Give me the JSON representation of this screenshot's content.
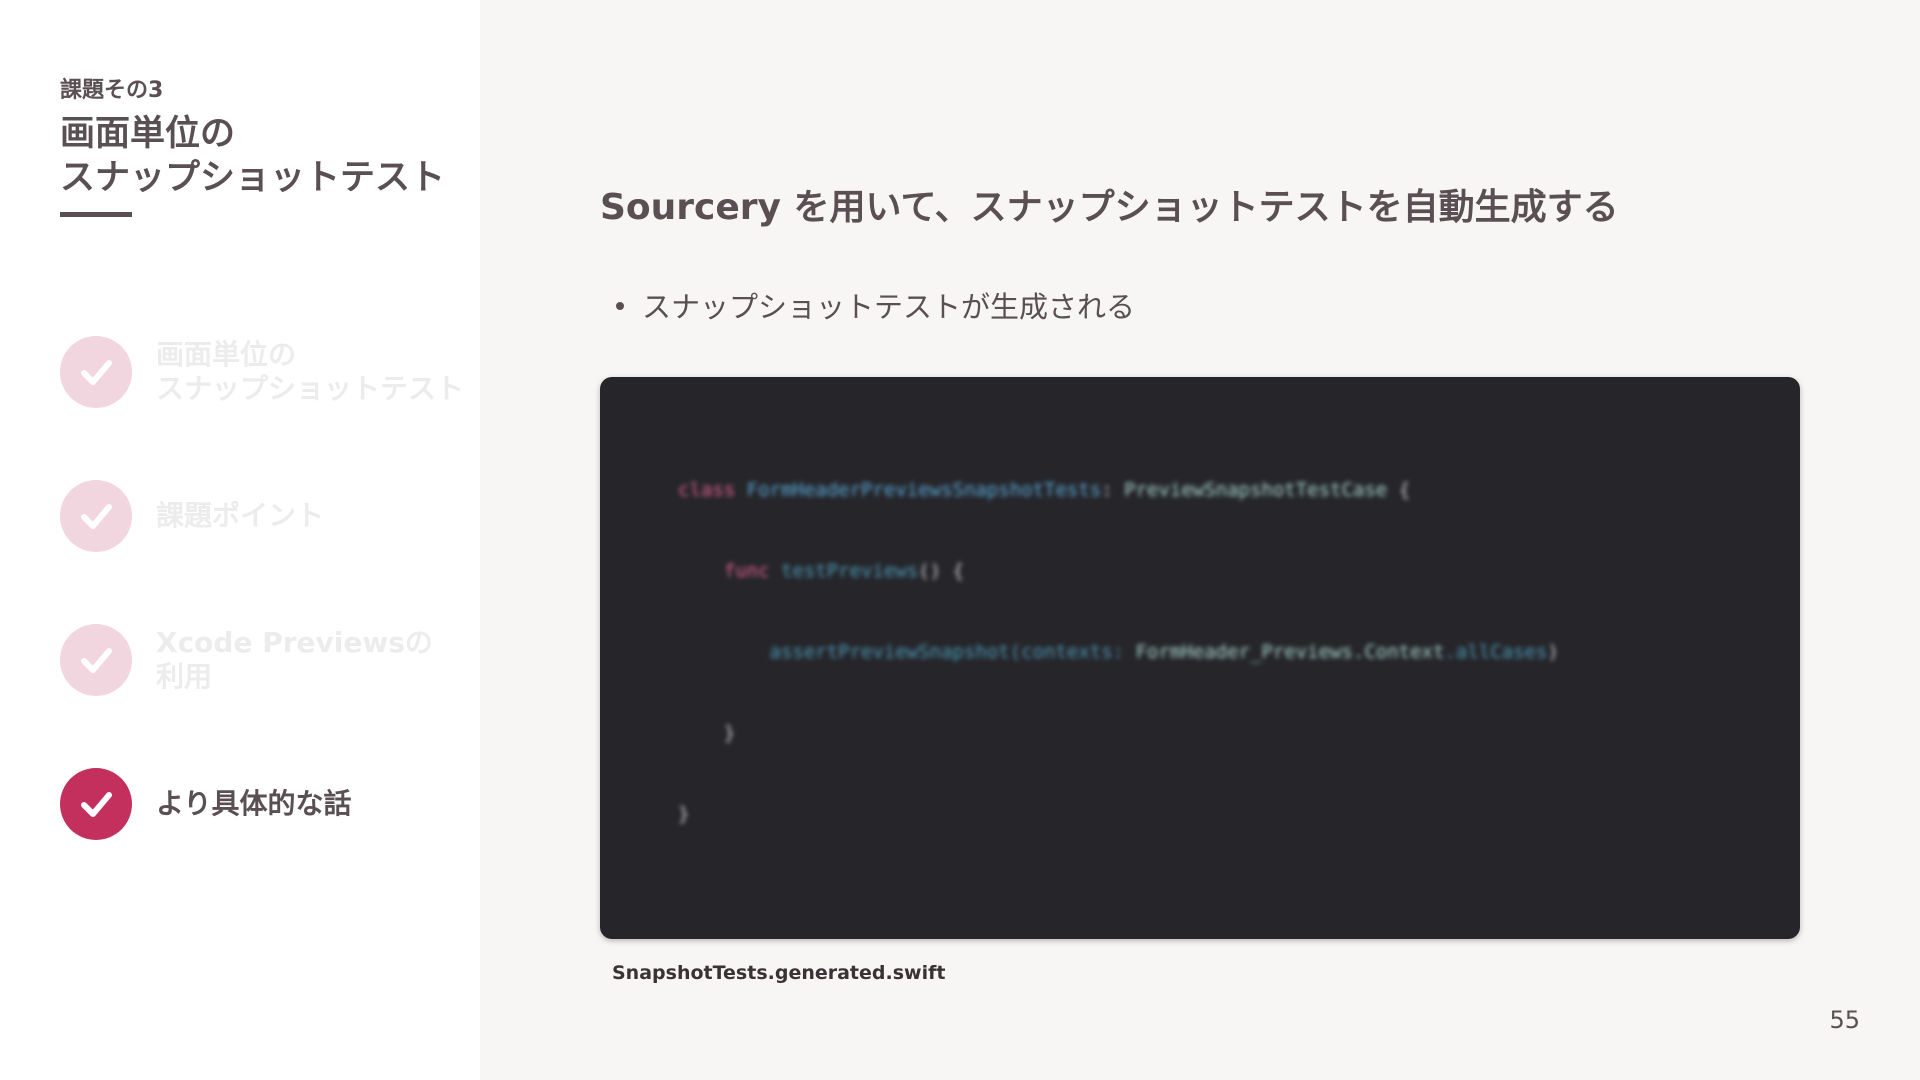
{
  "sidebar": {
    "eyebrow": "課題その3",
    "title_lines": [
      "画面単位の",
      "スナップショットテスト"
    ],
    "steps": [
      {
        "lines": [
          "画面単位の",
          "スナップショットテスト"
        ],
        "state": "done"
      },
      {
        "lines": [
          "課題ポイント"
        ],
        "state": "done"
      },
      {
        "lines": [
          "Xcode Previewsの",
          "利用"
        ],
        "state": "done"
      },
      {
        "lines": [
          "より具体的な話"
        ],
        "state": "current"
      }
    ],
    "check_icon": "checkmark-icon"
  },
  "main": {
    "heading": "Sourcery を用いて、スナップショットテストを自動生成する",
    "bullets": [
      "スナップショットテストが生成される"
    ],
    "code": {
      "lines": [
        [
          "class ",
          "FormHeaderPreviewsSnapshotTests",
          ": ",
          "PreviewSnapshotTestCase",
          " {"
        ],
        [
          "    func ",
          "testPreviews",
          "() {"
        ],
        [
          "        assertPreviewSnapshot",
          "(contexts: ",
          "FormHeader_Previews.Context",
          ".allCases",
          ")"
        ],
        [
          "    }"
        ],
        [
          "}"
        ]
      ]
    },
    "caption": "SnapshotTests.generated.swift"
  },
  "page_number": "55",
  "colors": {
    "accent": "#c4305e",
    "accent_faded": "#f2d6df",
    "text": "#5a4f52",
    "muted_text": "#ececec",
    "code_bg": "#26262a",
    "sidebar_bg": "#ffffff",
    "main_bg": "#f7f6f5"
  }
}
